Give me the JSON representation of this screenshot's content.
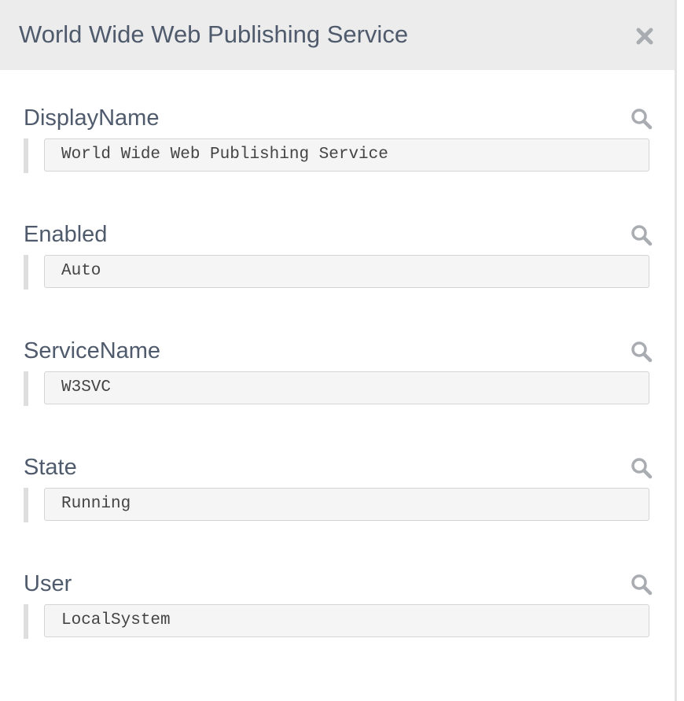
{
  "dialog": {
    "title": "World Wide Web Publishing Service"
  },
  "fields": [
    {
      "label": "DisplayName",
      "value": "World Wide Web Publishing Service"
    },
    {
      "label": "Enabled",
      "value": "Auto"
    },
    {
      "label": "ServiceName",
      "value": "W3SVC"
    },
    {
      "label": "State",
      "value": "Running"
    },
    {
      "label": "User",
      "value": "LocalSystem"
    }
  ],
  "icons": {
    "close": "close-icon",
    "search": "search-icon"
  },
  "colors": {
    "header_bg": "#ececec",
    "title_text": "#4f5b6c",
    "icon": "#a9acb1",
    "value_bg": "#f5f5f6"
  }
}
